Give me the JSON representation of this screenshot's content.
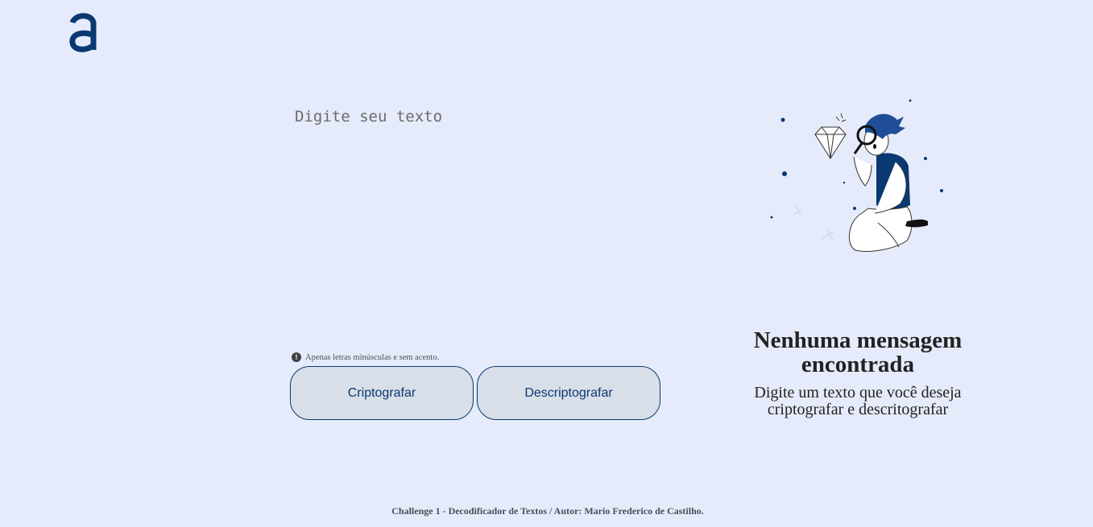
{
  "header": {
    "logo_icon": "alura-a-logo",
    "logo_color": "#0a3871"
  },
  "input": {
    "placeholder": "Digite seu texto",
    "value": ""
  },
  "hint": {
    "icon": "exclamation-circle-icon",
    "text": "Apenas letras minúsculas e sem acento."
  },
  "buttons": {
    "encrypt_label": "Criptografar",
    "decrypt_label": "Descriptografar"
  },
  "output": {
    "illustration": "person-with-magnifying-glass-and-diamond",
    "title": "Nenhuma mensagem encontrada",
    "subtitle": "Digite um texto que você deseja criptografar e descritografar"
  },
  "footer": {
    "text": "Challenge 1 - Decodificador de Textos / Autor: Mario Frederico de Castilho."
  },
  "colors": {
    "background": "#e5ebfa",
    "accent": "#0a3871",
    "button_bg": "#d8dfe8"
  }
}
